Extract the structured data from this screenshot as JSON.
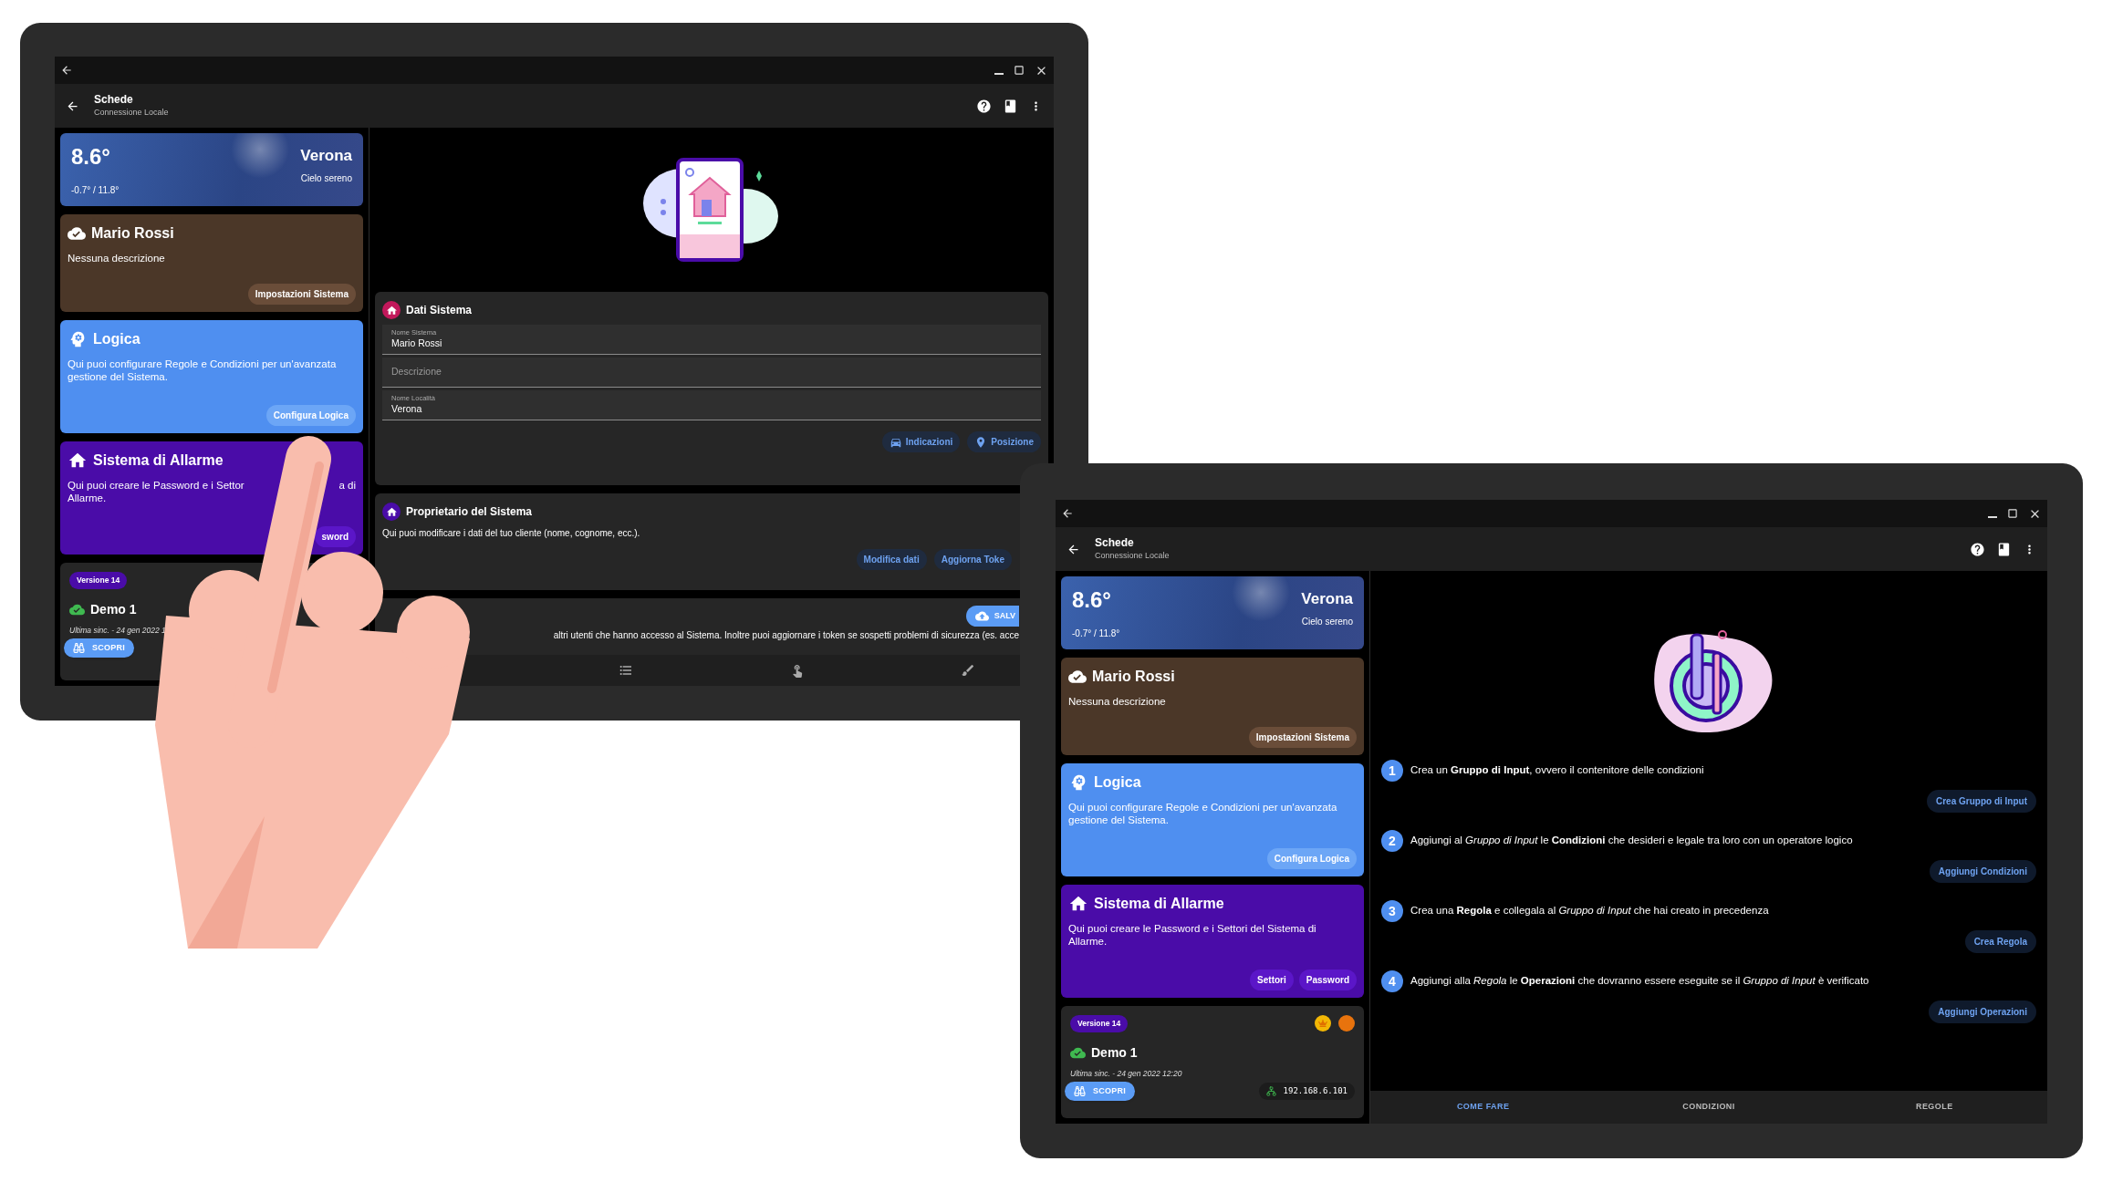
{
  "tablets": [
    {
      "window": {
        "title": "Schede",
        "subtitle": "Connessione Locale"
      },
      "sidebar": [
        {
          "kind": "weather",
          "temperature": "8.6°",
          "range": "-0.7° / 11.8°",
          "city": "Verona",
          "condition": "Cielo sereno"
        },
        {
          "kind": "system",
          "title": "Mario Rossi",
          "description": "Nessuna descrizione",
          "buttons": [
            "Impostazioni Sistema"
          ]
        },
        {
          "kind": "logic",
          "title": "Logica",
          "description": "Qui puoi configurare Regole e Condizioni per un'avanzata gestione del Sistema.",
          "buttons": [
            "Configura Logica"
          ]
        },
        {
          "kind": "alarm",
          "title": "Sistema di Allarme",
          "description_lines": [
            [
              "Qui puoi creare le Password e i Settor",
              "a di"
            ],
            [
              "Allarme."
            ]
          ],
          "buttons": [
            "sword"
          ]
        },
        {
          "kind": "version",
          "badge": "Versione 14",
          "name": "Demo 1",
          "sync": "Ultima sinc. - 24 gen 2022 1",
          "discover": "SCOPRI"
        }
      ],
      "main": {
        "kind": "system_data",
        "sections": [
          {
            "kind": "form",
            "title": "Dati Sistema",
            "fields": [
              {
                "label": "Nome Sistema",
                "value": "Mario Rossi"
              },
              {
                "placeholder": "Descrizione"
              },
              {
                "label": "Nome Località",
                "value": "Verona"
              }
            ],
            "buttons": [
              "Indicazioni",
              "Posizione"
            ]
          },
          {
            "kind": "info",
            "title": "Proprietario del Sistema",
            "description": "Qui puoi modificare i dati del tuo cliente (nome, cognome, ecc.).",
            "buttons": [
              "Modifica dati",
              "Aggiorna Toke"
            ]
          },
          {
            "kind": "partial",
            "save": "SALV",
            "description": "altri utenti che hanno accesso al Sistema. Inoltre puoi aggiornare i token se sospetti problemi di sicurezza (es. acce"
          }
        ]
      }
    },
    {
      "window": {
        "title": "Schede",
        "subtitle": "Connessione Locale"
      },
      "sidebar": [
        {
          "kind": "weather",
          "temperature": "8.6°",
          "range": "-0.7° / 11.8°",
          "city": "Verona",
          "condition": "Cielo sereno"
        },
        {
          "kind": "system",
          "title": "Mario Rossi",
          "description": "Nessuna descrizione",
          "buttons": [
            "Impostazioni Sistema"
          ]
        },
        {
          "kind": "logic",
          "title": "Logica",
          "description": "Qui puoi configurare Regole e Condizioni per un'avanzata gestione del Sistema.",
          "buttons": [
            "Configura Logica"
          ]
        },
        {
          "kind": "alarm",
          "title": "Sistema di Allarme",
          "description_lines": [
            [
              "Qui puoi creare le Password e i Settori del Sistema di Allarme."
            ]
          ],
          "buttons": [
            "Settori",
            "Password"
          ]
        },
        {
          "kind": "version",
          "badge": "Versione 14",
          "status_icons": true,
          "name": "Demo 1",
          "sync": "Ultima sinc. - 24 gen 2022 12:20",
          "discover": "SCOPRI",
          "address": "192.168.6.101"
        }
      ],
      "main": {
        "kind": "guide",
        "steps": [
          {
            "number": "1",
            "text": "Crea un **Gruppo di Input**, ovvero il contenitore delle condizioni",
            "button": "Crea Gruppo di Input"
          },
          {
            "number": "2",
            "text": "Aggiungi al *Gruppo di Input* le **Condizioni** che desideri e legale tra loro con un operatore logico",
            "button": "Aggiungi Condizioni"
          },
          {
            "number": "3",
            "text": "Crea una **Regola** e collegala al *Gruppo di Input* che hai creato in precedenza",
            "button": "Crea Regola"
          },
          {
            "number": "4",
            "text": "Aggiungi alla *Regola* le **Operazioni** che dovranno essere eseguite se il *Gruppo di Input* è verificato",
            "button": "Aggiungi Operazioni"
          }
        ],
        "tabs": [
          {
            "label": "COME FARE",
            "selected": true
          },
          {
            "label": "CONDIZIONI",
            "selected": false
          },
          {
            "label": "REGOLE",
            "selected": false
          }
        ]
      }
    }
  ]
}
